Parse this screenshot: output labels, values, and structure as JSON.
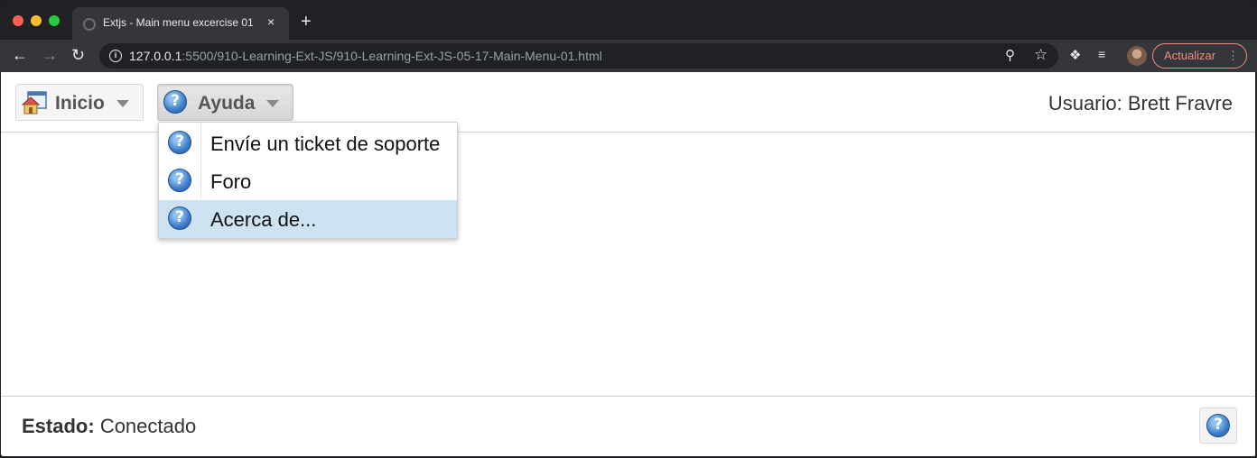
{
  "browser": {
    "tab_title": "Extjs - Main menu excercise 01",
    "tab_close": "×",
    "new_tab": "+",
    "url_host": "127.0.0.1",
    "url_path": ":5500/910-Learning-Ext-JS/910-Learning-Ext-JS-05-17-Main-Menu-01.html",
    "update_label": "Actualizar",
    "icons": {
      "back": "back-arrow-icon",
      "forward": "forward-arrow-icon",
      "reload": "reload-icon",
      "info": "info-icon",
      "zoom": "zoom-icon",
      "star": "star-icon",
      "extensions": "puzzle-icon",
      "media": "media-control-icon",
      "menu": "more-vertical-icon"
    },
    "colors": {
      "chrome_dark": "#202124",
      "toolbar": "#35363a",
      "update_accent": "#f28b82"
    }
  },
  "app": {
    "menu_buttons": [
      {
        "label": "Inicio",
        "icon": "home-icon"
      },
      {
        "label": "Ayuda",
        "icon": "help-question-icon"
      }
    ],
    "user_label": "Usuario: Brett Fravre",
    "dropdown": {
      "items": [
        {
          "label": "Envíe un ticket de soporte",
          "icon": "help-question-icon"
        },
        {
          "label": "Foro",
          "icon": "help-question-icon"
        },
        {
          "label": "Acerca de...",
          "icon": "help-question-icon",
          "highlighted": true
        }
      ]
    },
    "status": {
      "key": "Estado:",
      "value": "Conectado"
    },
    "colors": {
      "highlight": "#cee3f2",
      "help_icon": "#3d7cc9"
    }
  }
}
